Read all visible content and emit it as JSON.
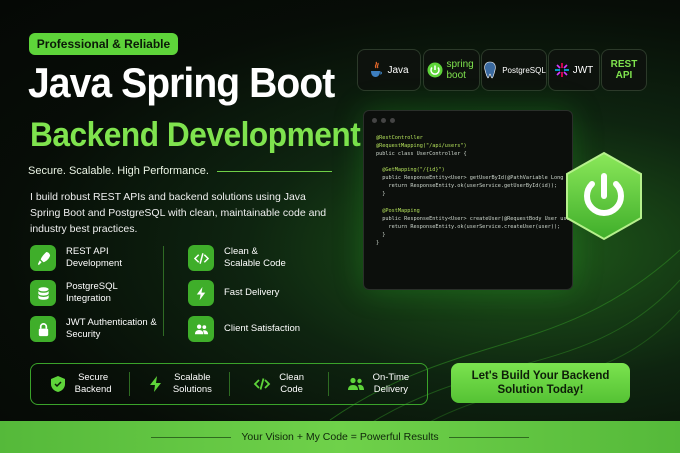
{
  "badge": "Professional & Reliable",
  "title_line1": "Java Spring Boot",
  "title_line2": "Backend Development",
  "tagline": "Secure. Scalable. High Performance.",
  "description": "I build robust REST APIs and backend solutions using Java Spring Boot and PostgreSQL with clean, maintainable code and industry best practices.",
  "features_left": [
    {
      "label": "REST API Development",
      "icon": "rocket-icon"
    },
    {
      "label": "PostgreSQL Integration",
      "icon": "database-icon"
    },
    {
      "label": "JWT Authentication & Security",
      "icon": "lock-icon"
    }
  ],
  "features_right": [
    {
      "label": "Clean & Scalable Code",
      "icon": "code-icon"
    },
    {
      "label": "Fast Delivery",
      "icon": "lightning-icon"
    },
    {
      "label": "Client Satisfaction",
      "icon": "users-icon"
    }
  ],
  "tech": {
    "java": "Java",
    "spring": "spring boot",
    "postgres": "PostgreSQL",
    "jwt": "JWT",
    "rest": "REST API"
  },
  "code_lines": [
    "@RestController",
    "@RequestMapping(\"/api/users\")",
    "public class UserController {",
    "",
    "  @GetMapping(\"/{id}\")",
    "  public ResponseEntity<User> getUserById(@PathVariable Long id) {",
    "    return ResponseEntity.ok(userService.getUserById(id));",
    "  }",
    "",
    "  @PostMapping",
    "  public ResponseEntity<User> createUser(@RequestBody User user) {",
    "    return ResponseEntity.ok(userService.createUser(user));",
    "  }",
    "}"
  ],
  "bottom_items": [
    {
      "line1": "Secure",
      "line2": "Backend",
      "icon": "shield-icon"
    },
    {
      "line1": "Scalable",
      "line2": "Solutions",
      "icon": "lightning-icon"
    },
    {
      "line1": "Clean",
      "line2": "Code",
      "icon": "code-icon"
    },
    {
      "line1": "On-Time",
      "line2": "Delivery",
      "icon": "users-icon"
    }
  ],
  "cta": {
    "line1": "Let's Build Your Backend",
    "line2": "Solution Today!"
  },
  "footer": "Your Vision + My Code = Powerful Results",
  "colors": {
    "accent": "#5ed43a",
    "accent_light": "#7fe34e",
    "background": "#070d07"
  }
}
